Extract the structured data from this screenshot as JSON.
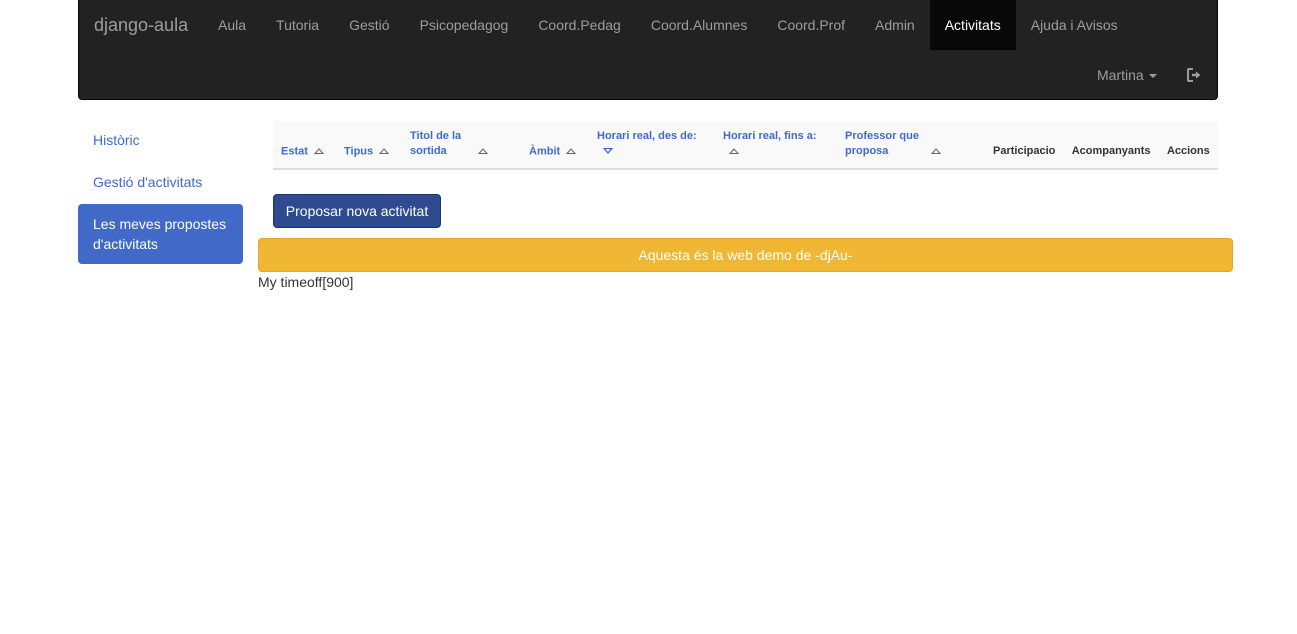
{
  "navbar": {
    "brand": "django-aula",
    "items": [
      {
        "label": "Aula"
      },
      {
        "label": "Tutoria"
      },
      {
        "label": "Gestió"
      },
      {
        "label": "Psicopedagog"
      },
      {
        "label": "Coord.Pedag"
      },
      {
        "label": "Coord.Alumnes"
      },
      {
        "label": "Coord.Prof"
      },
      {
        "label": "Admin"
      },
      {
        "label": "Activitats",
        "active": true
      },
      {
        "label": "Ajuda i Avisos"
      }
    ],
    "user": "Martina",
    "logout_icon": "sign-out-icon"
  },
  "sidebar": {
    "items": [
      {
        "label": "Històric"
      },
      {
        "label": "Gestió d'activitats"
      },
      {
        "label": "Les meves propostes d'activitats",
        "active": true
      }
    ]
  },
  "table": {
    "headers": [
      {
        "label": "Estat",
        "sortable": true,
        "sort": "none"
      },
      {
        "label": "Tipus",
        "sortable": true,
        "sort": "none"
      },
      {
        "label": "Titol de la sortida",
        "sortable": true,
        "sort": "none"
      },
      {
        "label": "Àmbit",
        "sortable": true,
        "sort": "none"
      },
      {
        "label": "Horari real, des de:",
        "sortable": true,
        "sort": "desc"
      },
      {
        "label": "Horari real, fins a:",
        "sortable": true,
        "sort": "none"
      },
      {
        "label": "Professor que proposa",
        "sortable": true,
        "sort": "none"
      },
      {
        "label": "Participacio",
        "sortable": false
      },
      {
        "label": "Acompanyants",
        "sortable": false
      },
      {
        "label": "Accions",
        "sortable": false
      }
    ],
    "rows": []
  },
  "actions": {
    "new_activity_label": "Proposar nova activitat"
  },
  "banner": {
    "text": "Aquesta és la web demo de -djAu-",
    "color": "#efb734"
  },
  "footer": {
    "timeoff_text": "My timeoff[900]"
  }
}
